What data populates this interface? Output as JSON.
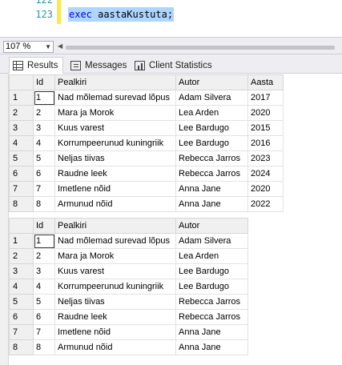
{
  "editor": {
    "line_numbers": [
      "122",
      "123"
    ],
    "code_keyword": "exec",
    "code_ident": "aastaKustuta",
    "code_end": ";"
  },
  "zoom": {
    "value": "107 %"
  },
  "tabs": [
    {
      "label": "Results",
      "icon": "grid-icon",
      "active": true
    },
    {
      "label": "Messages",
      "icon": "messages-icon",
      "active": false
    },
    {
      "label": "Client Statistics",
      "icon": "statistics-icon",
      "active": false
    }
  ],
  "grid1": {
    "columns": [
      "Id",
      "Pealkiri",
      "Autor",
      "Aasta"
    ],
    "rows": [
      [
        "1",
        "1",
        "Nad mõlemad surevad lõpus",
        "Adam Silvera",
        "2017"
      ],
      [
        "2",
        "2",
        "Mara ja Morok",
        "Lea Arden",
        "2020"
      ],
      [
        "3",
        "3",
        "Kuus varest",
        "Lee Bardugo",
        "2015"
      ],
      [
        "4",
        "4",
        "Korrumpeerunud kuningriik",
        "Lee Bardugo",
        "2016"
      ],
      [
        "5",
        "5",
        "Neljas tiivas",
        "Rebecca Jarros",
        "2023"
      ],
      [
        "6",
        "6",
        "Raudne leek",
        "Rebecca Jarros",
        "2024"
      ],
      [
        "7",
        "7",
        "Imetlene nõid",
        "Anna Jane",
        "2020"
      ],
      [
        "8",
        "8",
        "Armunud nõid",
        "Anna Jane",
        "2022"
      ]
    ]
  },
  "grid2": {
    "columns": [
      "Id",
      "Pealkiri",
      "Autor"
    ],
    "rows": [
      [
        "1",
        "1",
        "Nad mõlemad surevad lõpus",
        "Adam Silvera"
      ],
      [
        "2",
        "2",
        "Mara ja Morok",
        "Lea Arden"
      ],
      [
        "3",
        "3",
        "Kuus varest",
        "Lee Bardugo"
      ],
      [
        "4",
        "4",
        "Korrumpeerunud kuningriik",
        "Lee Bardugo"
      ],
      [
        "5",
        "5",
        "Neljas tiivas",
        "Rebecca Jarros"
      ],
      [
        "6",
        "6",
        "Raudne leek",
        "Rebecca Jarros"
      ],
      [
        "7",
        "7",
        "Imetlene nõid",
        "Anna Jane"
      ],
      [
        "8",
        "8",
        "Armunud nõid",
        "Anna Jane"
      ]
    ]
  }
}
